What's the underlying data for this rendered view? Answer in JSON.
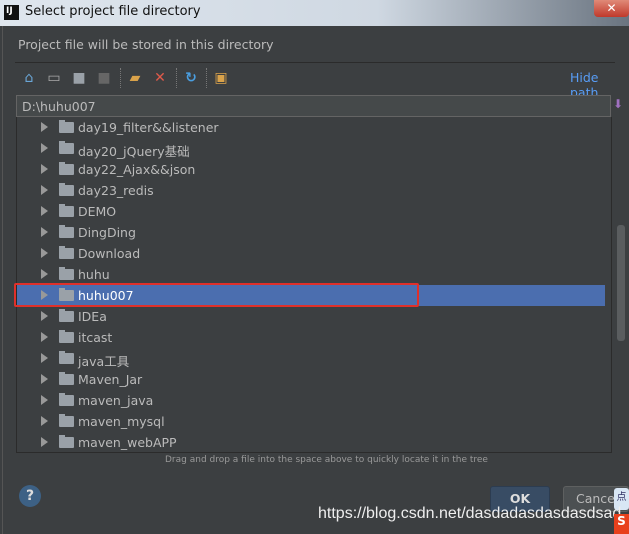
{
  "window": {
    "title": "Select project file directory",
    "logo": "IJ"
  },
  "dialog": {
    "description": "Project file will be stored in this directory",
    "hide_path": "Hide path",
    "path": "D:\\huhu007",
    "toolbar": [
      "home-icon",
      "desktop-icon",
      "project-folder-icon",
      "module-folder-icon",
      "new-folder-icon",
      "delete-icon",
      "refresh-icon",
      "show-hidden-icon"
    ],
    "tree": [
      {
        "name": "day19_filter&&listener"
      },
      {
        "name": "day20_jQuery基础"
      },
      {
        "name": "day22_Ajax&&json"
      },
      {
        "name": "day23_redis"
      },
      {
        "name": "DEMO"
      },
      {
        "name": "DingDing"
      },
      {
        "name": "Download"
      },
      {
        "name": "huhu"
      },
      {
        "name": "huhu007",
        "selected": true
      },
      {
        "name": "IDEa"
      },
      {
        "name": "itcast"
      },
      {
        "name": "java工具"
      },
      {
        "name": "Maven_Jar"
      },
      {
        "name": "maven_java"
      },
      {
        "name": "maven_mysql"
      },
      {
        "name": "maven_webAPP"
      }
    ],
    "hint": "Drag and drop a file into the space above to quickly locate it in the tree",
    "help": "?",
    "ok": "OK",
    "cancel": "Cancel"
  },
  "watermark": "https://blog.csdn.net/dasdadasdasdasdsad",
  "colors": {
    "selection": "#4b6eaf",
    "highlight_box": "#e0302a",
    "link": "#589df6"
  }
}
